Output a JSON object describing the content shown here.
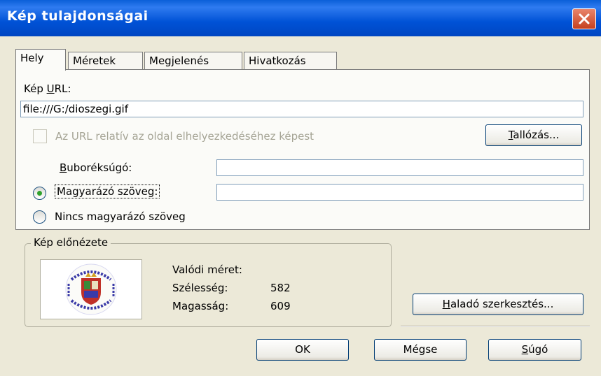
{
  "window": {
    "title": "Kép tulajdonságai"
  },
  "tabs": [
    {
      "label": "Hely",
      "active": true
    },
    {
      "label": "Méretek",
      "active": false
    },
    {
      "label": "Megjelenés",
      "active": false
    },
    {
      "label": "Hivatkozás",
      "active": false
    }
  ],
  "location": {
    "url_label_pre": "Kép ",
    "url_label_key": "U",
    "url_label_post": "RL:",
    "url_value": "file:///G:/dioszegi.gif",
    "relative_checkbox_label": "Az URL relatív az oldal elhelyezkedéséhez képest",
    "relative_checked": false,
    "browse_key": "T",
    "browse_rest": "allózás...",
    "tooltip_key": "B",
    "tooltip_rest": "uboréksúgó:",
    "tooltip_value": "",
    "alt_text_label": "Magyarázó szöveg:",
    "alt_text_value": "",
    "alt_text_selected": true,
    "no_alt_text_label": "Nincs magyarázó szöveg",
    "no_alt_text_selected": false
  },
  "preview": {
    "legend": "Kép előnézete",
    "actual_size_label": "Valódi méret:",
    "width_label": "Szélesség:",
    "width_value": "582",
    "height_label": "Magasság:",
    "height_value": "609"
  },
  "buttons": {
    "advanced_key": "H",
    "advanced_rest": "aladó szerkesztés...",
    "ok": "OK",
    "cancel": "Mégse",
    "help_key": "S",
    "help_rest": "úgó"
  },
  "colors": {
    "titlebar": "#0052d6",
    "dialog_bg": "#ece9d8",
    "close_button": "#c5401f",
    "radio_dot": "#2fa12d"
  }
}
